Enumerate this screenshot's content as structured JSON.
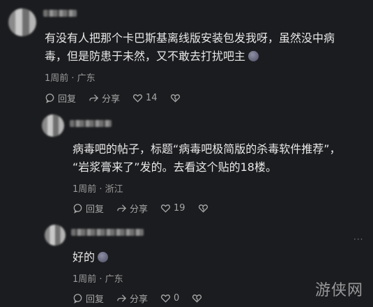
{
  "comments": [
    {
      "text_line1": "有没有人把那个卡巴斯基离线版安装包发我呀，虽然没中病",
      "text_line2": "毒，但是防患于未然，又不敢去打扰吧主",
      "meta": "1周前 · 广东",
      "reply_label": "回复",
      "share_label": "分享",
      "like_count": "14"
    },
    {
      "text_line1": "病毒吧的帖子，标题“病毒吧极简版的杀毒软件推荐”，",
      "text_line2": "“岩浆膏来了”发的。去看这个贴的18楼。",
      "meta": "1周前 · 浙江",
      "reply_label": "回复",
      "share_label": "分享",
      "like_count": "19"
    },
    {
      "text_line1": "好的",
      "meta": "1周前 · 广东",
      "reply_label": "回复",
      "share_label": "分享",
      "like_count": "0"
    }
  ],
  "watermark": "游侠网"
}
